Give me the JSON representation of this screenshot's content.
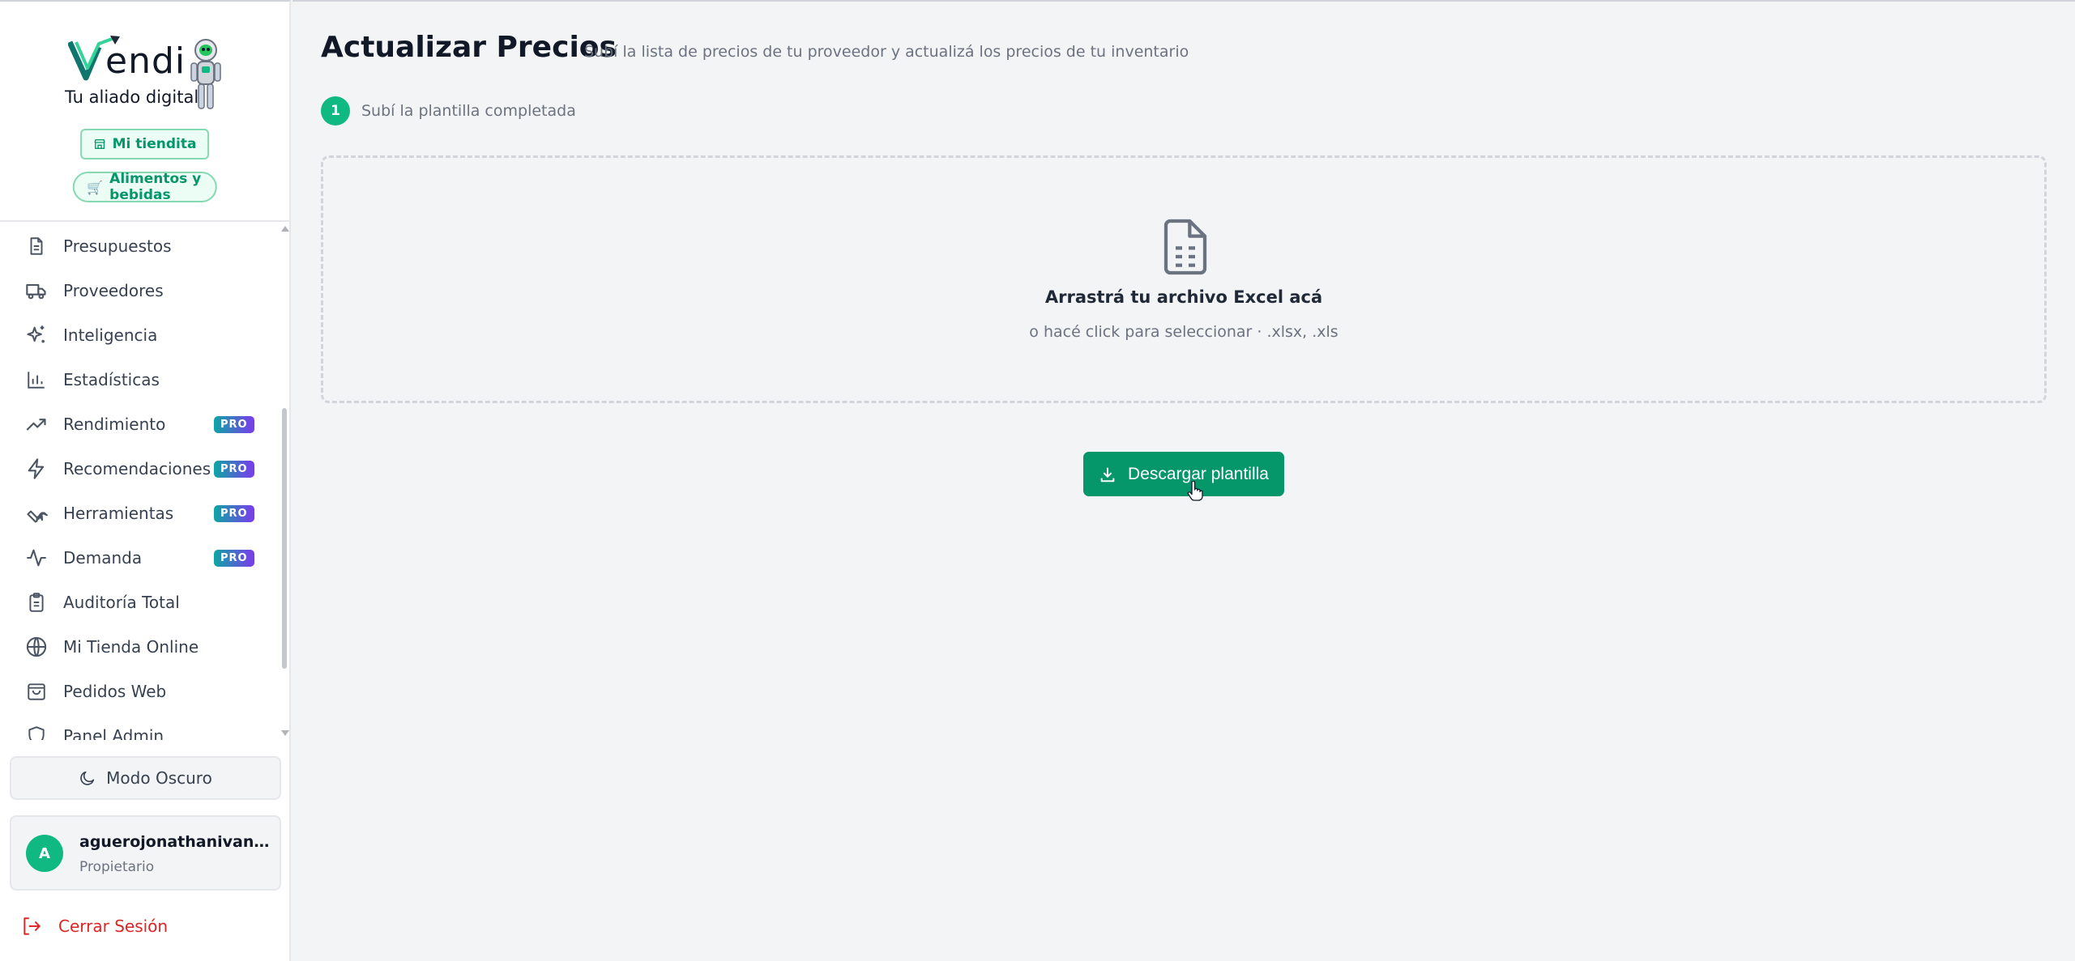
{
  "brand": {
    "logo_text": "endi",
    "tagline": "Tu aliado digital",
    "accent": "#10b981",
    "accent_dark": "#059669"
  },
  "sidebar": {
    "store_chip": "Mi tiendita",
    "category_chip": "Alimentos y bebidas",
    "pro_label": "PRO",
    "items": [
      {
        "label": "Presupuestos",
        "icon": "file-text-icon",
        "pro": false
      },
      {
        "label": "Proveedores",
        "icon": "truck-icon",
        "pro": false
      },
      {
        "label": "Inteligencia",
        "icon": "sparkles-icon",
        "pro": false
      },
      {
        "label": "Estadísticas",
        "icon": "bar-chart-icon",
        "pro": false
      },
      {
        "label": "Rendimiento",
        "icon": "trending-up-icon",
        "pro": true
      },
      {
        "label": "Recomendaciones",
        "icon": "zap-icon",
        "pro": true
      },
      {
        "label": "Herramientas",
        "icon": "wrench-icon",
        "pro": true
      },
      {
        "label": "Demanda",
        "icon": "activity-icon",
        "pro": true
      },
      {
        "label": "Auditoría Total",
        "icon": "clipboard-icon",
        "pro": false
      },
      {
        "label": "Mi Tienda Online",
        "icon": "globe-icon",
        "pro": false
      },
      {
        "label": "Pedidos Web",
        "icon": "shopping-bag-icon",
        "pro": false
      },
      {
        "label": "Panel Admin",
        "icon": "shield-icon",
        "pro": false
      }
    ],
    "dark_mode_label": "Modo Oscuro",
    "user": {
      "initial": "A",
      "email": "aguerojonathanivan@g...",
      "role": "Propietario"
    },
    "logout_label": "Cerrar Sesión"
  },
  "main": {
    "title": "Actualizar Precios",
    "subtitle": "Subí la lista de precios de tu proveedor y actualizá los precios de tu inventario",
    "step": {
      "number": "1",
      "label": "Subí la plantilla completada"
    },
    "dropzone": {
      "title": "Arrastrá tu archivo Excel acá",
      "hint": "o hacé click para seleccionar · .xlsx, .xls"
    },
    "download_button": "Descargar plantilla"
  }
}
